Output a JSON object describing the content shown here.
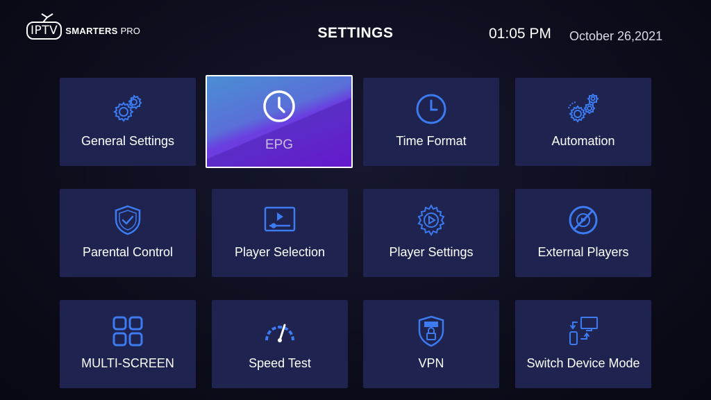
{
  "header": {
    "logo_iptv": "IPTV",
    "logo_smarters": "SMARTERS",
    "logo_pro": "PRO",
    "title": "SETTINGS",
    "time": "01:05 PM",
    "date": "October 26,2021"
  },
  "colors": {
    "tile_bg": "#1e2350",
    "icon_blue": "#3d7bf0",
    "active_gradient_start": "#4a8fd3",
    "active_gradient_end": "#7a21e8"
  },
  "tiles": [
    {
      "label": "General Settings",
      "icon": "gears-icon",
      "selected": false
    },
    {
      "label": "EPG",
      "icon": "clock-icon",
      "selected": true
    },
    {
      "label": "Time Format",
      "icon": "clock-icon",
      "selected": false
    },
    {
      "label": "Automation",
      "icon": "automation-gears-icon",
      "selected": false
    },
    {
      "label": "Parental Control",
      "icon": "shield-check-icon",
      "selected": false
    },
    {
      "label": "Player Selection",
      "icon": "player-screen-icon",
      "selected": false
    },
    {
      "label": "Player Settings",
      "icon": "gear-play-icon",
      "selected": false
    },
    {
      "label": "External Players",
      "icon": "no-external-player-icon",
      "selected": false
    },
    {
      "label": "MULTI-SCREEN",
      "icon": "grid-icon",
      "selected": false
    },
    {
      "label": "Speed Test",
      "icon": "speedometer-icon",
      "selected": false
    },
    {
      "label": "VPN",
      "icon": "vpn-shield-icon",
      "selected": false
    },
    {
      "label": "Switch Device Mode",
      "icon": "switch-device-icon",
      "selected": false
    }
  ]
}
